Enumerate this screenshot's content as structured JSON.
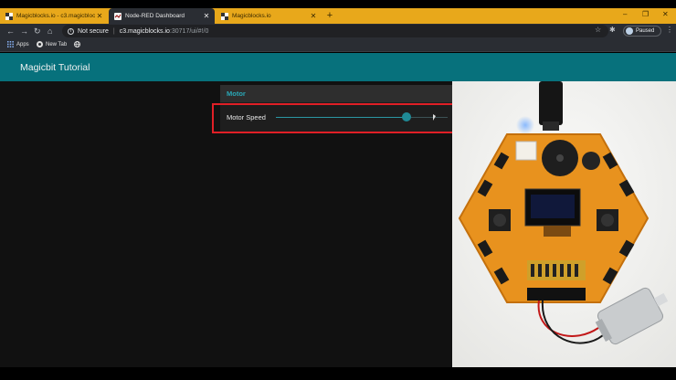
{
  "browser": {
    "tabs": [
      {
        "title": "Magicblocks.io - c3.magicblocks.io",
        "active": false
      },
      {
        "title": "Node-RED Dashboard",
        "active": true
      },
      {
        "title": "Magicblocks.io",
        "active": false
      }
    ],
    "new_tab_glyph": "+",
    "window_controls": {
      "minimize": "–",
      "maximize": "❐",
      "close": "✕"
    },
    "address": {
      "security_label": "Not secure",
      "host": "c3.magicblocks.io",
      "path": ":30717/ui/#!/0"
    },
    "profile_label": "Paused",
    "bookmarks": [
      {
        "label": "Apps",
        "icon": "apps-grid-icon"
      },
      {
        "label": "New Tab",
        "icon": "chrome-icon"
      },
      {
        "label": "",
        "icon": "globe-icon"
      }
    ]
  },
  "dashboard": {
    "title": "Magicbit Tutorial",
    "group": {
      "title": "Motor",
      "slider": {
        "label": "Motor Speed",
        "value_fraction": 0.76
      }
    }
  },
  "colors": {
    "tabstrip": "#e8a81b",
    "appbar": "#07717c",
    "accent": "#2aa7b6",
    "highlight": "#e01f26",
    "board_orange": "#e8921e"
  },
  "photo": {
    "subject": "magicbit-board-with-dc-motor"
  }
}
